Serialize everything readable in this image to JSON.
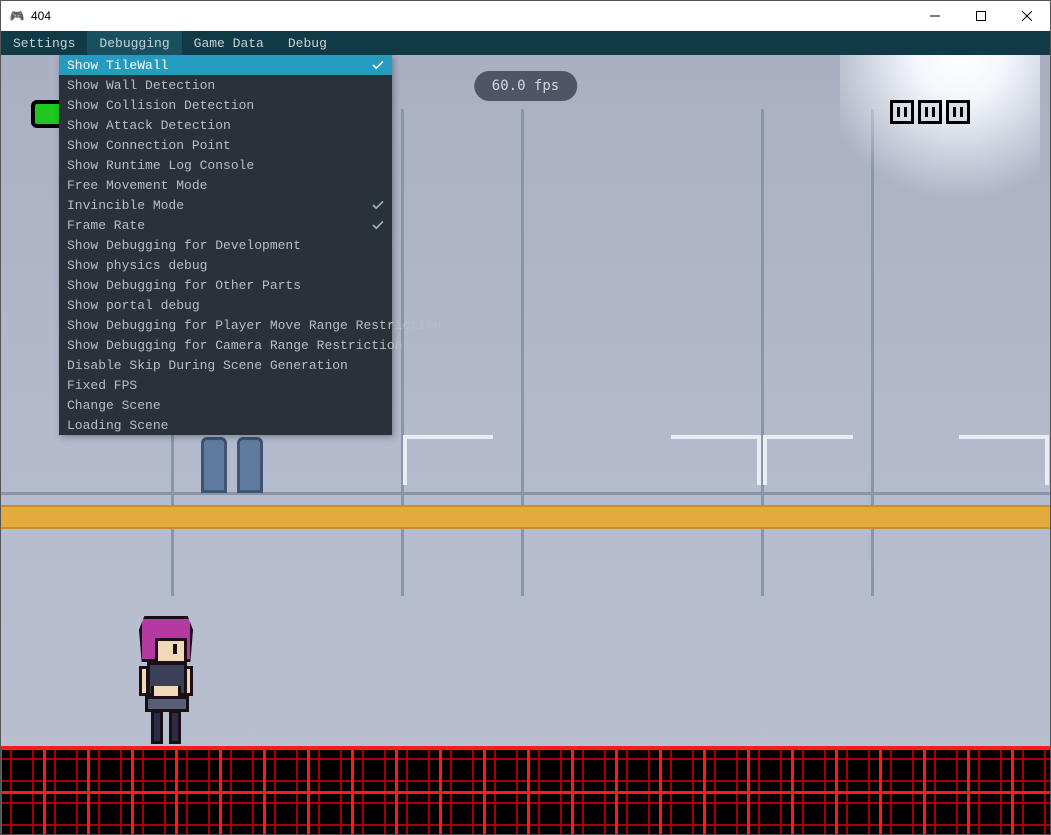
{
  "window": {
    "title": "404"
  },
  "menubar": {
    "items": [
      {
        "label": "Settings",
        "active": false
      },
      {
        "label": "Debugging",
        "active": true
      },
      {
        "label": "Game Data",
        "active": false
      },
      {
        "label": "Debug",
        "active": false
      }
    ]
  },
  "dropdown": {
    "items": [
      {
        "label": "Show TileWall",
        "checked": true,
        "highlighted": true
      },
      {
        "label": "Show Wall Detection",
        "checked": false
      },
      {
        "label": "Show Collision Detection",
        "checked": false
      },
      {
        "label": "Show Attack Detection",
        "checked": false
      },
      {
        "label": "Show Connection Point",
        "checked": false
      },
      {
        "label": "Show Runtime Log Console",
        "checked": false
      },
      {
        "label": "Free Movement Mode",
        "checked": false
      },
      {
        "label": "Invincible Mode",
        "checked": true
      },
      {
        "label": "Frame Rate",
        "checked": true
      },
      {
        "label": "Show Debugging for Development",
        "checked": false
      },
      {
        "label": "Show physics debug",
        "checked": false
      },
      {
        "label": "Show Debugging for Other Parts",
        "checked": false
      },
      {
        "label": "Show portal debug",
        "checked": false
      },
      {
        "label": "Show Debugging for Player Move Range Restriction",
        "checked": false
      },
      {
        "label": "Show Debugging for Camera Range Restriction",
        "checked": false
      },
      {
        "label": "Disable Skip During Scene Generation",
        "checked": false
      },
      {
        "label": "Fixed FPS",
        "checked": false
      },
      {
        "label": "Change Scene",
        "checked": false
      },
      {
        "label": "Loading Scene",
        "checked": false
      }
    ]
  },
  "hud": {
    "fps_text": "60.0 fps",
    "icon_slot_count": 3
  },
  "colors": {
    "menubar_bg": "#0f3a46",
    "dropdown_bg": "#283238",
    "highlight": "#259bbf",
    "floor_tile": "#ff1a1a",
    "accent_strip": "#e3ab3d"
  }
}
